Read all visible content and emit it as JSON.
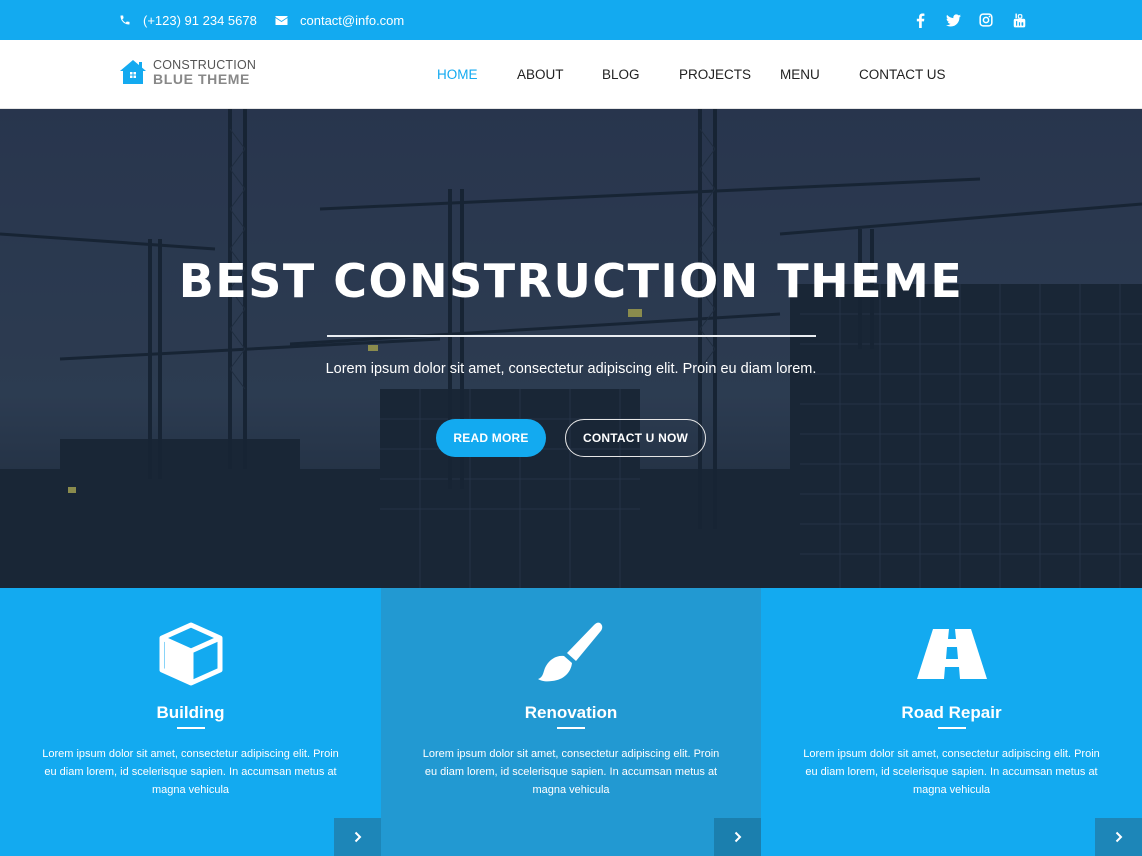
{
  "topbar": {
    "phone": "(+123) 91 234 5678",
    "email": "contact@info.com",
    "social": [
      "facebook-icon",
      "twitter-icon",
      "instagram-icon",
      "youtube-icon"
    ]
  },
  "header": {
    "logo_line1": "CONSTRUCTION",
    "logo_line2": "BLUE THEME",
    "nav": [
      {
        "label": "HOME",
        "active": true
      },
      {
        "label": "ABOUT",
        "active": false
      },
      {
        "label": "BLOG",
        "active": false
      },
      {
        "label": "PROJECTS",
        "active": false
      },
      {
        "label": "MENU",
        "active": false
      },
      {
        "label": "CONTACT US",
        "active": false
      }
    ]
  },
  "hero": {
    "title": "BEST CONSTRUCTION THEME",
    "subtitle": "Lorem ipsum dolor sit amet, consectetur adipiscing elit. Proin eu diam lorem.",
    "primary_button": "READ MORE",
    "secondary_button": "CONTACT U NOW"
  },
  "features": [
    {
      "title": "Building",
      "icon": "cube-icon",
      "text": "Lorem ipsum dolor sit amet, consectetur adipiscing elit. Proin eu diam lorem, id scelerisque sapien. In accumsan metus at magna vehicula"
    },
    {
      "title": "Renovation",
      "icon": "paintbrush-icon",
      "text": "Lorem ipsum dolor sit amet, consectetur adipiscing elit. Proin eu diam lorem, id scelerisque sapien. In accumsan metus at magna vehicula"
    },
    {
      "title": "Road Repair",
      "icon": "road-icon",
      "text": "Lorem ipsum dolor sit amet, consectetur adipiscing elit. Proin eu diam lorem, id scelerisque sapien. In accumsan metus at magna vehicula"
    }
  ],
  "colors": {
    "accent": "#13aaf0",
    "accent_dark": "#2299d2",
    "hero_bg": "#2b3547"
  }
}
